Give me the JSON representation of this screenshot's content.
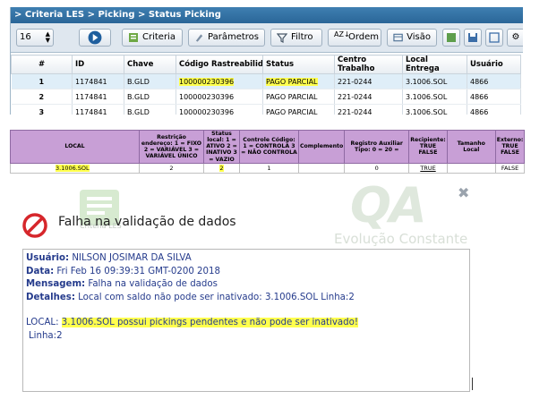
{
  "breadcrumb": "> Criteria LES > Picking > Status Picking",
  "toolbar": {
    "page_size": "16",
    "buttons": [
      {
        "label": "Criteria",
        "icon": "criteria-icon"
      },
      {
        "label": "Parâmetros",
        "icon": "params-icon"
      },
      {
        "label": "Filtro",
        "icon": "filter-icon"
      },
      {
        "label": "Ordem",
        "icon": "sort-icon"
      },
      {
        "label": "Visão",
        "icon": "view-icon"
      }
    ]
  },
  "grid1": {
    "columns": [
      "#",
      "ID",
      "Chave",
      "Código Rastreabilidade",
      "Status",
      "Centro Trabalho",
      "Local Entrega",
      "Usuário"
    ],
    "rows": [
      [
        "1",
        "1174841",
        "B.GLD",
        "100000230396",
        "PAGO PARCIAL",
        "221-0244",
        "3.1006.SOL",
        "4866"
      ],
      [
        "2",
        "1174841",
        "B.GLD",
        "100000230396",
        "PAGO PARCIAL",
        "221-0244",
        "3.1006.SOL",
        "4866"
      ],
      [
        "3",
        "1174841",
        "B.GLD",
        "100000230396",
        "PAGO PARCIAL",
        "221-0244",
        "3.1006.SOL",
        "4866"
      ]
    ]
  },
  "grid2": {
    "headers": [
      "LOCAL",
      "Restrição endereço: 1 = FIXO 2 = VARIÁVEL 3 = VARIÁVEL ÚNICO",
      "Status local: 1 = ATIVO 2 = INATIVO 3 = VAZIO",
      "Controle Código: 1 = CONTROLA 3 = NÃO CONTROLA",
      "Complemento",
      "Registro Auxiliar Tipo: 0 = 20 =",
      "Recipiente: TRUE FALSE",
      "Tamanho Local",
      "Externo: TRUE FALSE"
    ],
    "row": [
      "3.1006.SOL",
      "2",
      "2",
      "1",
      "",
      "0",
      "TRUE",
      "",
      "FALSE"
    ]
  },
  "dialog": {
    "title": "Falha na validação de dados",
    "watermark": "QA",
    "watermark_sub": "Evolução Constante",
    "bg_label": "Criteria LES",
    "usuario_label": "Usuário:",
    "usuario": "NILSON JOSIMAR DA SILVA",
    "data_label": "Data:",
    "data": "Fri Feb 16 09:39:31 GMT-0200 2018",
    "mensagem_label": "Mensagem:",
    "mensagem": "Falha na validação de dados",
    "detalhes_label": "Detalhes:",
    "detalhes": "Local com saldo não pode ser inativado: 3.1006.SOL Linha:2",
    "local_prefix": "LOCAL: ",
    "local_msg": "3.1006.SOL possui pickings pendentes e não pode ser inativado!",
    "linha": "Linha:2"
  },
  "colors": {
    "titlebar": "#2f6ea3",
    "highlight": "#ffff4d",
    "grid2_header": "#c89fd6",
    "message_text": "#253b8c",
    "error": "#d6262b"
  }
}
